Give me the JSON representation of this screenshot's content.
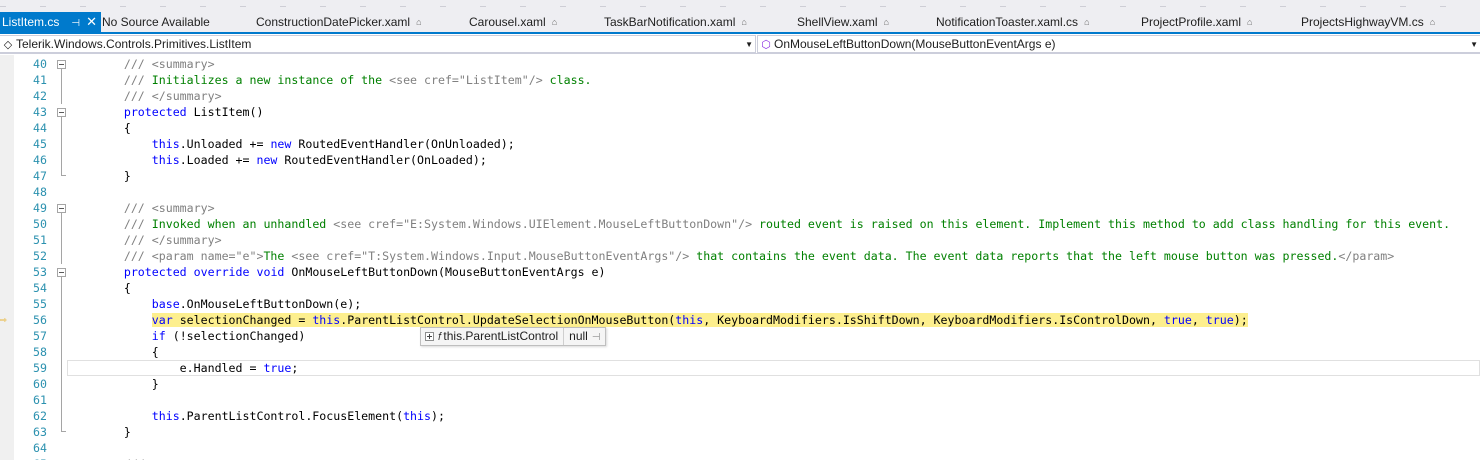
{
  "tabs": [
    {
      "label": "ListItem.cs",
      "active": true,
      "left": 0
    },
    {
      "label": "No Source Available",
      "active": false,
      "locked": false
    },
    {
      "label": "ConstructionDatePicker.xaml",
      "active": false,
      "locked": true
    },
    {
      "label": "Carousel.xaml",
      "active": false,
      "locked": true
    },
    {
      "label": "TaskBarNotification.xaml",
      "active": false,
      "locked": true
    },
    {
      "label": "ShellView.xaml",
      "active": false,
      "locked": true
    },
    {
      "label": "NotificationToaster.xaml.cs",
      "active": false,
      "locked": true
    },
    {
      "label": "ProjectProfile.xaml",
      "active": false,
      "locked": true
    },
    {
      "label": "ProjectsHighwayVM.cs",
      "active": false,
      "locked": true
    }
  ],
  "navbar": {
    "type_name": "Telerik.Windows.Controls.Primitives.ListItem",
    "member_name": "OnMouseLeftButtonDown(MouseButtonEventArgs e)"
  },
  "editor": {
    "current_line": 56,
    "lines": [
      {
        "n": "40",
        "fold": "box",
        "segs": [
          [
            "        ",
            ""
          ],
          [
            "/// <summary>",
            "gray"
          ]
        ]
      },
      {
        "n": "41",
        "fold": "v",
        "segs": [
          [
            "        ",
            ""
          ],
          [
            "///",
            "gray"
          ],
          [
            " Initializes a new instance of the ",
            "green"
          ],
          [
            "<see cref=\"ListItem\"/>",
            "gray"
          ],
          [
            " class.",
            "green"
          ]
        ]
      },
      {
        "n": "42",
        "fold": "v",
        "segs": [
          [
            "        ",
            ""
          ],
          [
            "/// </summary>",
            "gray"
          ]
        ]
      },
      {
        "n": "43",
        "fold": "box",
        "segs": [
          [
            "        ",
            ""
          ],
          [
            "protected",
            "blue"
          ],
          [
            " ListItem()",
            "black"
          ]
        ]
      },
      {
        "n": "44",
        "fold": "v",
        "segs": [
          [
            "        {",
            "black"
          ]
        ]
      },
      {
        "n": "45",
        "fold": "v",
        "segs": [
          [
            "            ",
            ""
          ],
          [
            "this",
            "blue"
          ],
          [
            ".Unloaded += ",
            "black"
          ],
          [
            "new",
            "blue"
          ],
          [
            " RoutedEventHandler(OnUnloaded);",
            "black"
          ]
        ]
      },
      {
        "n": "46",
        "fold": "v",
        "segs": [
          [
            "            ",
            ""
          ],
          [
            "this",
            "blue"
          ],
          [
            ".Loaded += ",
            "black"
          ],
          [
            "new",
            "blue"
          ],
          [
            " RoutedEventHandler(OnLoaded);",
            "black"
          ]
        ]
      },
      {
        "n": "47",
        "fold": "end",
        "segs": [
          [
            "        }",
            "black"
          ]
        ]
      },
      {
        "n": "48",
        "fold": "",
        "segs": []
      },
      {
        "n": "49",
        "fold": "box",
        "segs": [
          [
            "        ",
            ""
          ],
          [
            "/// <summary>",
            "gray"
          ]
        ]
      },
      {
        "n": "50",
        "fold": "v",
        "segs": [
          [
            "        ",
            ""
          ],
          [
            "///",
            "gray"
          ],
          [
            " Invoked when an unhandled ",
            "green"
          ],
          [
            "<see cref=\"E:System.Windows.UIElement.MouseLeftButtonDown\"/>",
            "gray"
          ],
          [
            " routed event is raised on this element. Implement this method to add class handling for this event.",
            "green"
          ]
        ]
      },
      {
        "n": "51",
        "fold": "v",
        "segs": [
          [
            "        ",
            ""
          ],
          [
            "/// </summary>",
            "gray"
          ]
        ]
      },
      {
        "n": "52",
        "fold": "v",
        "segs": [
          [
            "        ",
            ""
          ],
          [
            "/// <param name=\"e\">",
            "gray"
          ],
          [
            "The ",
            "green"
          ],
          [
            "<see cref=\"T:System.Windows.Input.MouseButtonEventArgs\"/>",
            "gray"
          ],
          [
            " that contains the event data. The event data reports that the left mouse button was pressed.",
            "green"
          ],
          [
            "</param>",
            "gray"
          ]
        ]
      },
      {
        "n": "53",
        "fold": "box",
        "segs": [
          [
            "        ",
            ""
          ],
          [
            "protected",
            "blue"
          ],
          [
            " ",
            "black"
          ],
          [
            "override",
            "blue"
          ],
          [
            " ",
            "black"
          ],
          [
            "void",
            "blue"
          ],
          [
            " OnMouseLeftButtonDown(MouseButtonEventArgs e)",
            "black"
          ]
        ]
      },
      {
        "n": "54",
        "fold": "v",
        "segs": [
          [
            "        {",
            "black"
          ]
        ]
      },
      {
        "n": "55",
        "fold": "v",
        "segs": [
          [
            "            ",
            ""
          ],
          [
            "base",
            "blue"
          ],
          [
            ".OnMouseLeftButtonDown(e);",
            "black"
          ]
        ]
      },
      {
        "n": "56",
        "fold": "v",
        "current": true,
        "segs": [
          [
            "            ",
            ""
          ],
          [
            "var",
            "blue",
            "hl"
          ],
          [
            " selectionChanged = ",
            "black",
            "hl"
          ],
          [
            "this",
            "blue",
            "hl"
          ],
          [
            ".ParentListControl.UpdateSelectionOnMouseButton(",
            "black",
            "hl"
          ],
          [
            "this",
            "blue",
            "hl"
          ],
          [
            ", KeyboardModifiers.IsShiftDown, KeyboardModifiers.IsControlDown, ",
            "black",
            "hl"
          ],
          [
            "true",
            "blue",
            "hl"
          ],
          [
            ", ",
            "black",
            "hl"
          ],
          [
            "true",
            "blue",
            "hl"
          ],
          [
            ");",
            "black",
            "hl"
          ]
        ]
      },
      {
        "n": "57",
        "fold": "v",
        "segs": [
          [
            "            ",
            ""
          ],
          [
            "if",
            "blue"
          ],
          [
            " (!selectionChanged)",
            "black"
          ]
        ]
      },
      {
        "n": "58",
        "fold": "v",
        "segs": [
          [
            "            {",
            "black"
          ]
        ]
      },
      {
        "n": "59",
        "fold": "v",
        "cursor": true,
        "segs": [
          [
            "                e.Handled = ",
            "black"
          ],
          [
            "true",
            "blue"
          ],
          [
            ";",
            "black"
          ]
        ]
      },
      {
        "n": "60",
        "fold": "v",
        "segs": [
          [
            "            }",
            "black"
          ]
        ]
      },
      {
        "n": "61",
        "fold": "v",
        "segs": []
      },
      {
        "n": "62",
        "fold": "v",
        "segs": [
          [
            "            ",
            ""
          ],
          [
            "this",
            "blue"
          ],
          [
            ".ParentListControl.FocusElement(",
            "black"
          ],
          [
            "this",
            "blue"
          ],
          [
            ");",
            "black"
          ]
        ]
      },
      {
        "n": "63",
        "fold": "end",
        "segs": [
          [
            "        }",
            "black"
          ]
        ]
      },
      {
        "n": "64",
        "fold": "",
        "segs": []
      },
      {
        "n": "65",
        "fold": "box",
        "segs": [
          [
            "        ",
            ""
          ],
          [
            "///",
            "gray"
          ]
        ]
      }
    ]
  },
  "datatip": {
    "expression": "this.ParentListControl",
    "value": "null",
    "icon": "property-wrench-icon"
  },
  "colors": {
    "accent": "#007acc",
    "current_line_bg": "#fdef8e",
    "line_number": "#2b91af",
    "keyword": "#0000ff",
    "comment": "#008000",
    "xml_doc": "#808080"
  }
}
